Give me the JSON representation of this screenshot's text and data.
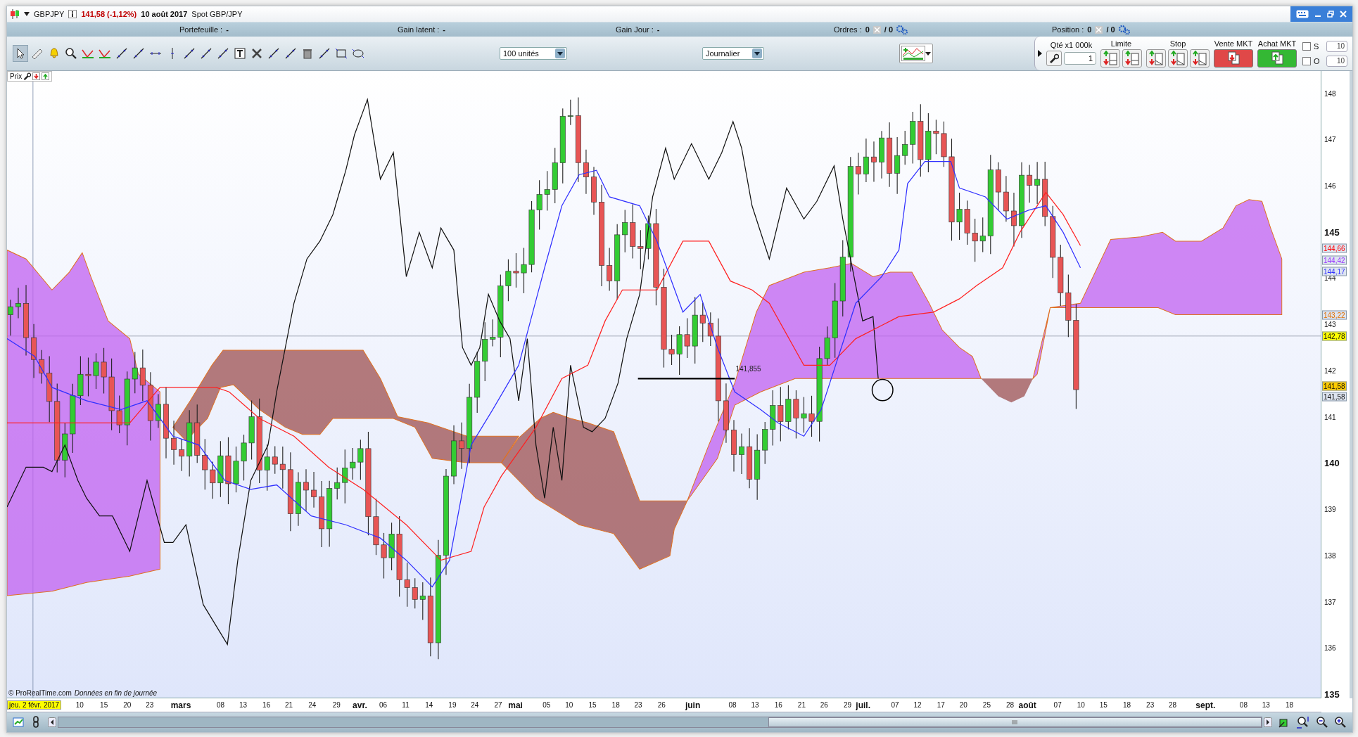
{
  "window": {
    "symbol": "GBPJPY",
    "change": "141,58 (-1,12%)",
    "date": "10 août 2017",
    "instrument": "Spot GBP/JPY"
  },
  "info_bar": [
    {
      "kind": "text",
      "label": "Portefeuille :",
      "value": "-"
    },
    {
      "kind": "text",
      "label": "Gain latent :",
      "value": "-"
    },
    {
      "kind": "text",
      "label": "Gain Jour :",
      "value": "-"
    },
    {
      "kind": "orders",
      "label": "Ordres :",
      "value": "0",
      "total": "/ 0"
    },
    {
      "kind": "orders",
      "label": "Position :",
      "value": "0",
      "total": "/ 0"
    }
  ],
  "toolbar": {
    "quantity": "100 unités",
    "period": "Journalier"
  },
  "order_panel": {
    "qty_label": "Qté x1 000k",
    "qty": "1",
    "limit_label": "Limite",
    "stop_label": "Stop",
    "sell": "Vente MKT",
    "buy": "Achat MKT",
    "options": [
      {
        "label": "S",
        "value": "10",
        "checked": false
      },
      {
        "label": "O",
        "value": "10",
        "checked": false
      }
    ]
  },
  "chart": {
    "panel_label": "Prix",
    "level_label": "141,855",
    "copyright": "© ProRealTime.com",
    "note": "Données en fin de journée",
    "cursor_date": "jeu. 2 févr. 2017",
    "y_ticks": [
      {
        "label": "148",
        "major": false
      },
      {
        "label": "147",
        "major": false
      },
      {
        "label": "146",
        "major": false
      },
      {
        "label": "145",
        "major": true
      },
      {
        "label": "144",
        "major": false
      },
      {
        "label": "143",
        "major": false
      },
      {
        "label": "142",
        "major": false
      },
      {
        "label": "141",
        "major": false
      },
      {
        "label": "140",
        "major": true
      },
      {
        "label": "139",
        "major": false
      },
      {
        "label": "138",
        "major": false
      },
      {
        "label": "137",
        "major": false
      },
      {
        "label": "136",
        "major": false
      },
      {
        "label": "135",
        "major": true
      }
    ],
    "price_tags": [
      {
        "value": "144,66",
        "color": "#ff0000",
        "kind": "outline"
      },
      {
        "value": "144,42",
        "color": "#9933ff",
        "kind": "outline"
      },
      {
        "value": "144,17",
        "color": "#3333ff",
        "kind": "outline"
      },
      {
        "value": "143,22",
        "color": "#e07000",
        "kind": "outline"
      },
      {
        "value": "142,78",
        "color": "#ffff00",
        "kind": "filled"
      },
      {
        "value": "141,58",
        "color": "#ffcc00",
        "kind": "filled"
      },
      {
        "value": "141,58",
        "color": "#dde4f0",
        "kind": "filled"
      }
    ],
    "x_labels": [
      {
        "label": "10",
        "major": false
      },
      {
        "label": "15",
        "major": false
      },
      {
        "label": "20",
        "major": false
      },
      {
        "label": "23",
        "major": false
      },
      {
        "label": "mars",
        "major": true
      },
      {
        "label": "08",
        "major": false
      },
      {
        "label": "13",
        "major": false
      },
      {
        "label": "16",
        "major": false
      },
      {
        "label": "21",
        "major": false
      },
      {
        "label": "24",
        "major": false
      },
      {
        "label": "29",
        "major": false
      },
      {
        "label": "avr.",
        "major": true
      },
      {
        "label": "06",
        "major": false
      },
      {
        "label": "11",
        "major": false
      },
      {
        "label": "14",
        "major": false
      },
      {
        "label": "19",
        "major": false
      },
      {
        "label": "24",
        "major": false
      },
      {
        "label": "27",
        "major": false
      },
      {
        "label": "mai",
        "major": true
      },
      {
        "label": "05",
        "major": false
      },
      {
        "label": "10",
        "major": false
      },
      {
        "label": "15",
        "major": false
      },
      {
        "label": "18",
        "major": false
      },
      {
        "label": "23",
        "major": false
      },
      {
        "label": "26",
        "major": false
      },
      {
        "label": "juin",
        "major": true
      },
      {
        "label": "08",
        "major": false
      },
      {
        "label": "13",
        "major": false
      },
      {
        "label": "16",
        "major": false
      },
      {
        "label": "21",
        "major": false
      },
      {
        "label": "26",
        "major": false
      },
      {
        "label": "29",
        "major": false
      },
      {
        "label": "juil.",
        "major": true
      },
      {
        "label": "07",
        "major": false
      },
      {
        "label": "12",
        "major": false
      },
      {
        "label": "17",
        "major": false
      },
      {
        "label": "20",
        "major": false
      },
      {
        "label": "25",
        "major": false
      },
      {
        "label": "28",
        "major": false
      },
      {
        "label": "août",
        "major": true
      },
      {
        "label": "07",
        "major": false
      },
      {
        "label": "10",
        "major": false
      },
      {
        "label": "15",
        "major": false
      },
      {
        "label": "18",
        "major": false
      },
      {
        "label": "23",
        "major": false
      },
      {
        "label": "28",
        "major": false
      },
      {
        "label": "sept.",
        "major": true
      },
      {
        "label": "08",
        "major": false
      },
      {
        "label": "13",
        "major": false
      },
      {
        "label": "18",
        "major": false
      }
    ]
  }
}
